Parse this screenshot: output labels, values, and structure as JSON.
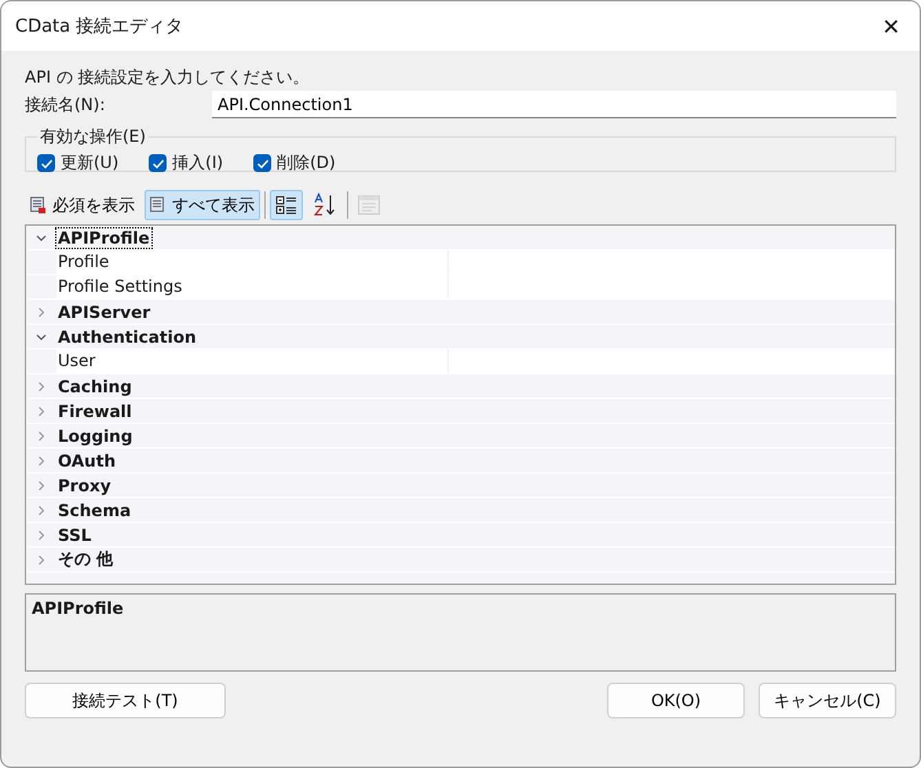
{
  "window": {
    "title": "CData 接続エディタ",
    "close": "✕"
  },
  "instruction": "API の 接続設定を入力してください。",
  "connection_name": {
    "label": "接続名(N):",
    "value": "API.Connection1"
  },
  "operations": {
    "legend": "有効な操作(E)",
    "items": [
      {
        "label": "更新(U)",
        "checked": true
      },
      {
        "label": "挿入(I)",
        "checked": true
      },
      {
        "label": "削除(D)",
        "checked": true
      }
    ]
  },
  "toolbar": [
    {
      "kind": "text",
      "label": "必須を表示",
      "selected": false,
      "disabled": false
    },
    {
      "kind": "text",
      "label": "すべて表示",
      "selected": true,
      "disabled": false
    },
    {
      "kind": "categorized",
      "selected": true,
      "disabled": false
    },
    {
      "kind": "alphabetical",
      "selected": false,
      "disabled": false
    },
    {
      "kind": "pages",
      "selected": false,
      "disabled": true
    }
  ],
  "property_grid": [
    {
      "name": "APIProfile",
      "expanded": true,
      "selected": true,
      "children": [
        {
          "name": "Profile"
        },
        {
          "name": "Profile Settings"
        }
      ]
    },
    {
      "name": "APIServer",
      "expanded": false,
      "selected": false
    },
    {
      "name": "Authentication",
      "expanded": true,
      "selected": false,
      "children": [
        {
          "name": "User"
        }
      ]
    },
    {
      "name": "Caching",
      "expanded": false,
      "selected": false
    },
    {
      "name": "Firewall",
      "expanded": false,
      "selected": false
    },
    {
      "name": "Logging",
      "expanded": false,
      "selected": false
    },
    {
      "name": "OAuth",
      "expanded": false,
      "selected": false
    },
    {
      "name": "Proxy",
      "expanded": false,
      "selected": false
    },
    {
      "name": "Schema",
      "expanded": false,
      "selected": false
    },
    {
      "name": "SSL",
      "expanded": false,
      "selected": false
    },
    {
      "name": "その 他",
      "expanded": false,
      "selected": false
    }
  ],
  "description": "APIProfile",
  "buttons": {
    "test": "接続テスト(T)",
    "ok": "OK(O)",
    "cancel": "キャンセル(C)"
  }
}
